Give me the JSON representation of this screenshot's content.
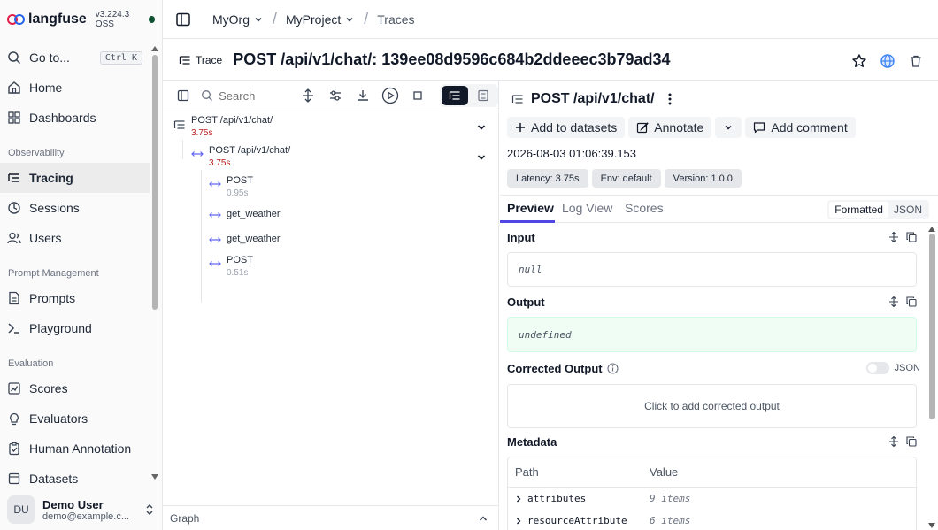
{
  "brand": {
    "name": "langfuse",
    "version": "v3.224.3 OSS"
  },
  "sidebar": {
    "goto": {
      "label": "Go to...",
      "shortcut": "Ctrl K"
    },
    "top_items": [
      {
        "label": "Home"
      },
      {
        "label": "Dashboards"
      }
    ],
    "sections": [
      {
        "title": "Observability",
        "items": [
          {
            "label": "Tracing"
          },
          {
            "label": "Sessions"
          },
          {
            "label": "Users"
          }
        ]
      },
      {
        "title": "Prompt Management",
        "items": [
          {
            "label": "Prompts"
          },
          {
            "label": "Playground"
          }
        ]
      },
      {
        "title": "Evaluation",
        "items": [
          {
            "label": "Scores"
          },
          {
            "label": "Evaluators"
          },
          {
            "label": "Human Annotation"
          },
          {
            "label": "Datasets"
          }
        ]
      }
    ],
    "active": "Tracing",
    "user": {
      "initials": "DU",
      "name": "Demo User",
      "email": "demo@example.c..."
    }
  },
  "topbar": {
    "org": "MyOrg",
    "project": "MyProject",
    "page": "Traces"
  },
  "trace": {
    "tag": "Trace",
    "title": "POST /api/v1/chat/: 139ee08d9596c684b2ddeeec3b79ad34"
  },
  "tree_toolbar": {
    "search_placeholder": "Search"
  },
  "tree": [
    {
      "name": "POST /api/v1/chat/",
      "duration": "3.75s"
    },
    {
      "name": "POST /api/v1/chat/",
      "duration": "3.75s"
    },
    {
      "name": "POST",
      "duration": "0.95s"
    },
    {
      "name": "get_weather",
      "duration": ""
    },
    {
      "name": "get_weather",
      "duration": ""
    },
    {
      "name": "POST",
      "duration": "0.51s"
    }
  ],
  "graph_label": "Graph",
  "observation": {
    "title": "POST /api/v1/chat/",
    "actions": {
      "add_to_datasets": "Add to datasets",
      "annotate": "Annotate",
      "add_comment": "Add comment"
    },
    "timestamp": "2026-08-03 01:06:39.153",
    "badges": {
      "latency": "Latency: 3.75s",
      "env": "Env: default",
      "version": "Version: 1.0.0"
    },
    "tabs": {
      "preview": "Preview",
      "log_view": "Log View",
      "scores": "Scores"
    },
    "format": {
      "formatted": "Formatted",
      "json": "JSON"
    },
    "input": {
      "label": "Input",
      "value": "null"
    },
    "output": {
      "label": "Output",
      "value": "undefined"
    },
    "corrected": {
      "label": "Corrected Output",
      "json_label": "JSON",
      "placeholder": "Click to add corrected output"
    },
    "metadata": {
      "label": "Metadata",
      "columns": {
        "path": "Path",
        "value": "Value"
      },
      "rows": [
        {
          "path": "attributes",
          "value": "9 items"
        },
        {
          "path": "resourceAttribute",
          "value": "6 items"
        }
      ]
    }
  },
  "colors": {
    "accent": "#4f46e5",
    "duration": "#b91c1c",
    "span_icon": "#6366f1",
    "output_bg": "#f0fdf4"
  }
}
